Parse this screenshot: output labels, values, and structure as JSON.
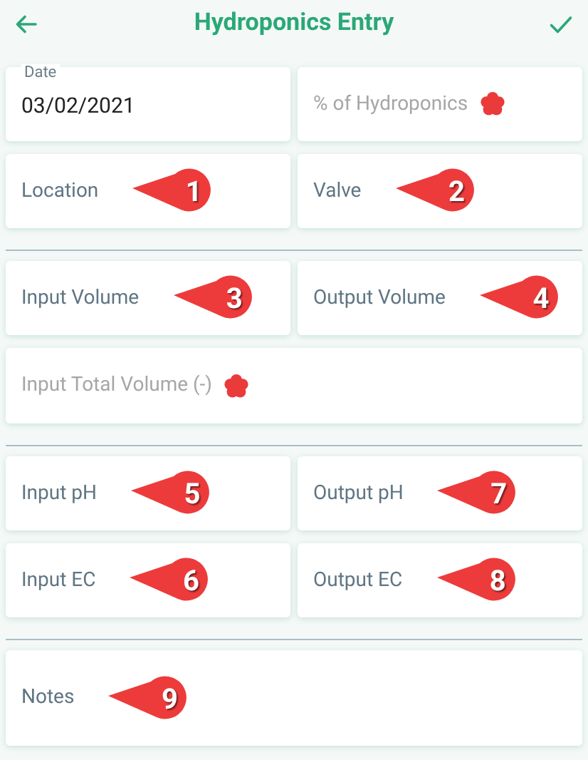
{
  "header": {
    "title": "Hydroponics Entry"
  },
  "sections": [
    {
      "fields": [
        {
          "kind": "half",
          "label": "Date",
          "value": "03/02/2021",
          "required": false
        },
        {
          "kind": "half",
          "label": "% of Hydroponics",
          "required": true
        },
        {
          "kind": "half",
          "label": "Location",
          "required": false,
          "callout": "1"
        },
        {
          "kind": "half",
          "label": "Valve",
          "required": false,
          "callout": "2"
        }
      ]
    },
    {
      "fields": [
        {
          "kind": "half",
          "label": "Input Volume",
          "required": false,
          "callout": "3"
        },
        {
          "kind": "half",
          "label": "Output Volume",
          "required": false,
          "callout": "4"
        },
        {
          "kind": "wide",
          "label": "Input Total Volume (-)",
          "required": true
        }
      ]
    },
    {
      "fields": [
        {
          "kind": "half",
          "label": "Input pH",
          "required": false,
          "callout": "5"
        },
        {
          "kind": "half",
          "label": "Output pH",
          "required": false,
          "callout": "7"
        },
        {
          "kind": "half",
          "label": "Input EC",
          "required": false,
          "callout": "6"
        },
        {
          "kind": "half",
          "label": "Output EC",
          "required": false,
          "callout": "8"
        }
      ]
    },
    {
      "fields": [
        {
          "kind": "multiline",
          "label": "Notes",
          "required": false,
          "callout": "9"
        }
      ]
    }
  ]
}
